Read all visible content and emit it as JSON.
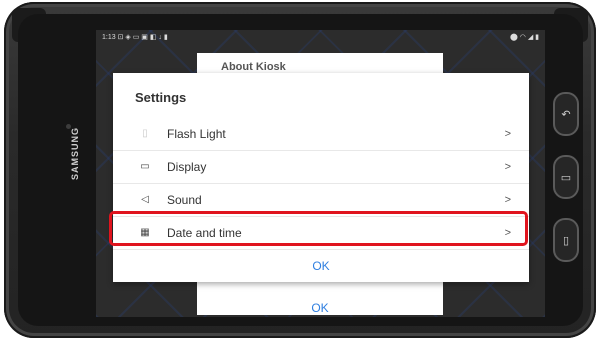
{
  "device": {
    "brand": "SAMSUNG",
    "info_icon": "i",
    "right_buttons": [
      "back-icon",
      "home-icon",
      "recents-icon"
    ]
  },
  "status_bar": {
    "time": "1:13",
    "left_icons": "⊡ ◈ ▭ ▣ ◧ ↓ ▮",
    "right_icons": "⬤ ◠ ◢ ▮"
  },
  "back_card": {
    "title": "About Kiosk",
    "ok_label": "OK"
  },
  "dialog": {
    "title": "Settings",
    "items": [
      {
        "label": "Flash Light",
        "icon": "flashlight-icon",
        "glyph": "▯"
      },
      {
        "label": "Display",
        "icon": "display-icon",
        "glyph": "▭"
      },
      {
        "label": "Sound",
        "icon": "sound-icon",
        "glyph": "◁"
      },
      {
        "label": "Date and time",
        "icon": "calendar-clock-icon",
        "glyph": "▦"
      }
    ],
    "chevron": ">",
    "ok_label": "OK"
  },
  "colors": {
    "accent": "#2f7fe0",
    "highlight": "#e0141e"
  }
}
